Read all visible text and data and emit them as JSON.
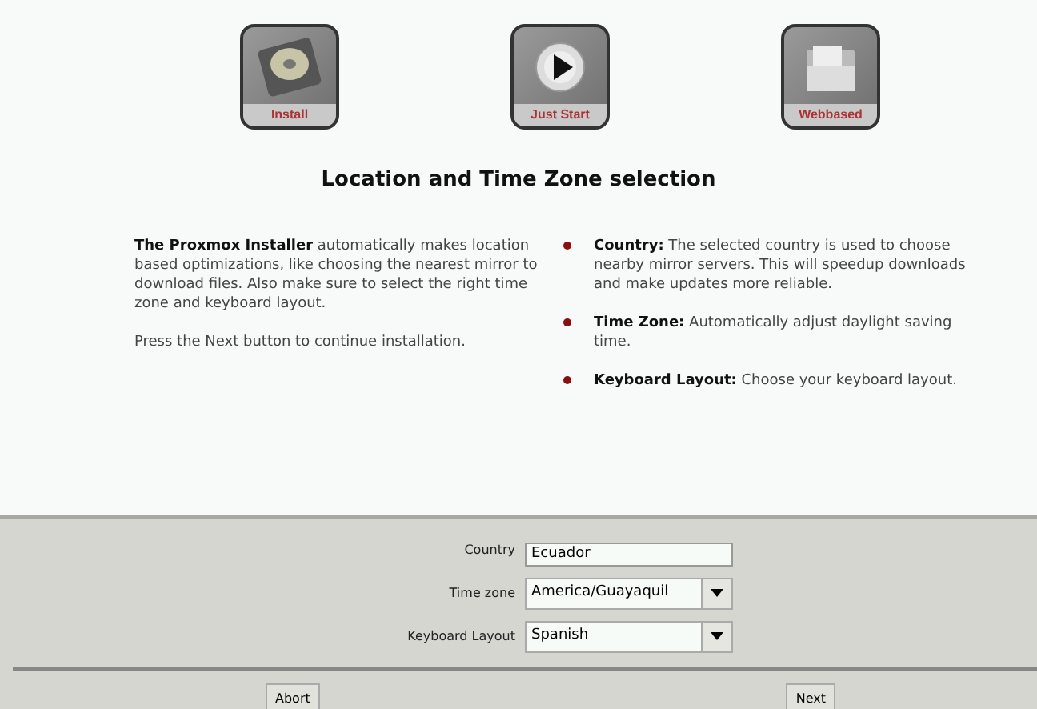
{
  "modes": [
    {
      "label": "Install",
      "kind": "disk"
    },
    {
      "label": "Just Start",
      "kind": "play"
    },
    {
      "label": "Webbased",
      "kind": "folder"
    }
  ],
  "title": "Location and Time Zone selection",
  "intro": [
    "**The Proxmox Installer** automatically makes location based optimizations, like choosing the nearest mirror to download files. Also make sure to select the right time zone and keyboard layout.",
    "Press the Next button to continue installation."
  ],
  "bullets": [
    "**Country:** The selected country is used to choose nearby mirror servers. This will speedup downloads and make updates more reliable.",
    "**Time Zone:** Automatically adjust daylight saving time.",
    "**Keyboard Layout:** Choose your keyboard layout."
  ],
  "form": [
    {
      "label": "Country",
      "value": "Ecuador",
      "kind": "entry"
    },
    {
      "label": "Time zone",
      "value": "America/Guayaquil",
      "kind": "combo"
    },
    {
      "label": "Keyboard Layout",
      "value": "Spanish",
      "kind": "combo"
    }
  ],
  "buttons": [
    "Abort",
    "Next"
  ]
}
